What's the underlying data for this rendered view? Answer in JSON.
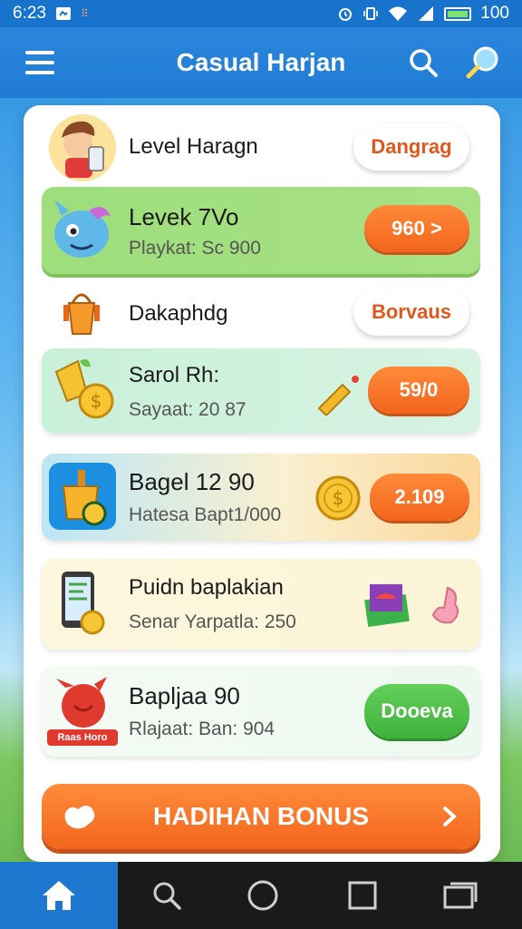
{
  "status_bar": {
    "time": "6:23",
    "battery_text": "100"
  },
  "app_bar": {
    "title": "Casual Harjan"
  },
  "rows": [
    {
      "title": "Level Haragn",
      "button": "Dangrag",
      "icon": "player-avatar-icon"
    },
    {
      "title": "Levek 7Vo",
      "subtitle": "Playkat: Sc 900",
      "button": "960 >",
      "icon": "blue-monster-icon"
    },
    {
      "title": "Dakaphdg",
      "button": "Borvaus",
      "icon": "orange-bag-icon"
    },
    {
      "title": "Sarol Rh:",
      "subtitle": "Sayaat: 20 87",
      "button": "59/0",
      "icon": "coins-treasure-icon"
    },
    {
      "title": "Bagel 12 90",
      "subtitle": "Hatesa Bapt1/000",
      "button": "2.109",
      "icon": "honey-jar-icon"
    },
    {
      "title": "Puidn baplakian",
      "subtitle": "Senar Yarpatla: 250",
      "icon": "phone-coin-icon"
    },
    {
      "title": "Bapljaa 90",
      "subtitle": "Rlajaat: Ban: 904",
      "button": "Dooeva",
      "icon": "red-bird-icon",
      "icon_label": "Raas Horo"
    }
  ],
  "bonus_button": {
    "label": "HADIHAN BONUS"
  },
  "colors": {
    "accent_orange": "#f2651c",
    "accent_green": "#3fb23c",
    "header_blue": "#1f7bd4"
  }
}
